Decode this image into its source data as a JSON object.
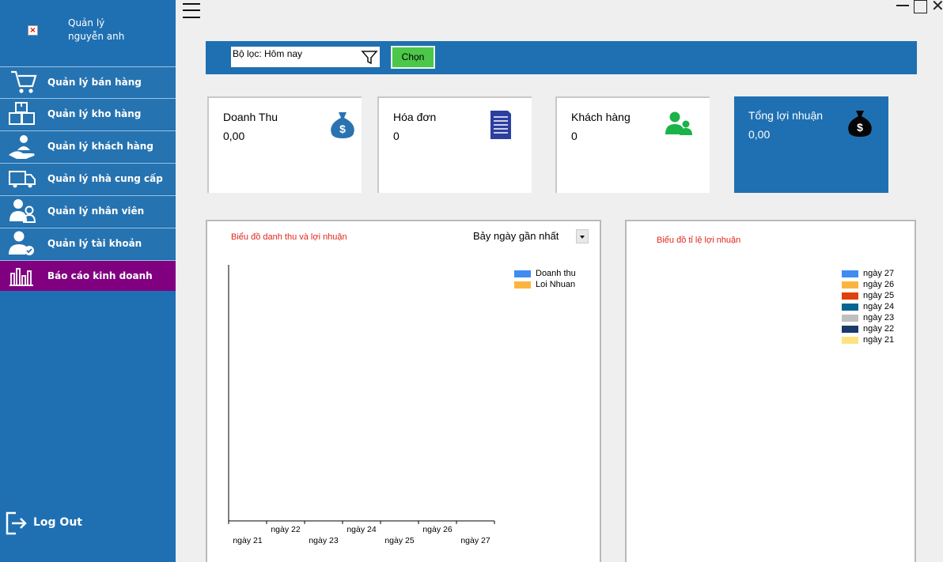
{
  "sidebar": {
    "user_name": "Quản lý nguyễn anh",
    "items": [
      {
        "label": "Quản lý bán hàng",
        "icon": "shopping-cart-icon"
      },
      {
        "label": "Quản lý kho hàng",
        "icon": "boxes-icon"
      },
      {
        "label": "Quản lý khách hàng",
        "icon": "customer-hand-icon"
      },
      {
        "label": "Quản lý nhà cung cấp",
        "icon": "delivery-truck-icon"
      },
      {
        "label": "Quản lý nhân viên",
        "icon": "employees-icon"
      },
      {
        "label": "Quản lý tài khoản",
        "icon": "user-check-icon"
      },
      {
        "label": "Báo cáo kinh doanh",
        "icon": "bar-chart-icon"
      }
    ],
    "active_index": 6,
    "logout_label": "Log Out",
    "colors": {
      "background": "#1f70b2",
      "active": "#800080"
    }
  },
  "filter": {
    "label": "Bộ lọc: Hôm nay",
    "button_label": "Chọn"
  },
  "cards": [
    {
      "title": "Doanh Thu",
      "value": "0,00",
      "icon": "money-bag-icon"
    },
    {
      "title": "Hóa đơn",
      "value": "0",
      "icon": "invoice-document-icon"
    },
    {
      "title": "Khách hàng",
      "value": "0",
      "icon": "customers-icon"
    },
    {
      "title": "Tổng lợi nhuận",
      "value": "0,00",
      "icon": "money-bag-dark-icon"
    }
  ],
  "revenue_chart": {
    "title": "Biểu đồ danh thu và lợi nhuận",
    "range_selected": "Bảy ngày gần nhất",
    "legend": [
      {
        "name": "Doanh thu",
        "color": "#418cf0"
      },
      {
        "name": "Loi Nhuan",
        "color": "#fcb441"
      }
    ]
  },
  "profit_chart": {
    "title": "Biểu đồ tỉ lệ lợi nhuận",
    "legend": [
      {
        "name": "ngày 27",
        "color": "#418cf0"
      },
      {
        "name": "ngày 26",
        "color": "#fcb441"
      },
      {
        "name": "ngày 25",
        "color": "#e0400a"
      },
      {
        "name": "ngày 24",
        "color": "#056492"
      },
      {
        "name": "ngày 23",
        "color": "#bfbfbf"
      },
      {
        "name": "ngày 22",
        "color": "#1a3b69"
      },
      {
        "name": "ngày 21",
        "color": "#ffe382"
      }
    ]
  },
  "chart_data": [
    {
      "type": "bar",
      "title": "Biểu đồ danh thu và lợi nhuận",
      "categories": [
        "ngày 21",
        "ngày 22",
        "ngày 23",
        "ngày 24",
        "ngày 25",
        "ngày 26",
        "ngày 27"
      ],
      "series": [
        {
          "name": "Doanh thu",
          "values": [
            0,
            0,
            0,
            0,
            0,
            0,
            0
          ]
        },
        {
          "name": "Loi Nhuan",
          "values": [
            0,
            0,
            0,
            0,
            0,
            0,
            0
          ]
        }
      ],
      "xlabel": "",
      "ylabel": "",
      "legend": "top-right",
      "grid": false
    },
    {
      "type": "pie",
      "title": "Biểu đồ tỉ lệ lợi nhuận",
      "categories": [
        "ngày 27",
        "ngày 26",
        "ngày 25",
        "ngày 24",
        "ngày 23",
        "ngày 22",
        "ngày 21"
      ],
      "values": [
        0,
        0,
        0,
        0,
        0,
        0,
        0
      ],
      "legend": "top-right"
    }
  ]
}
